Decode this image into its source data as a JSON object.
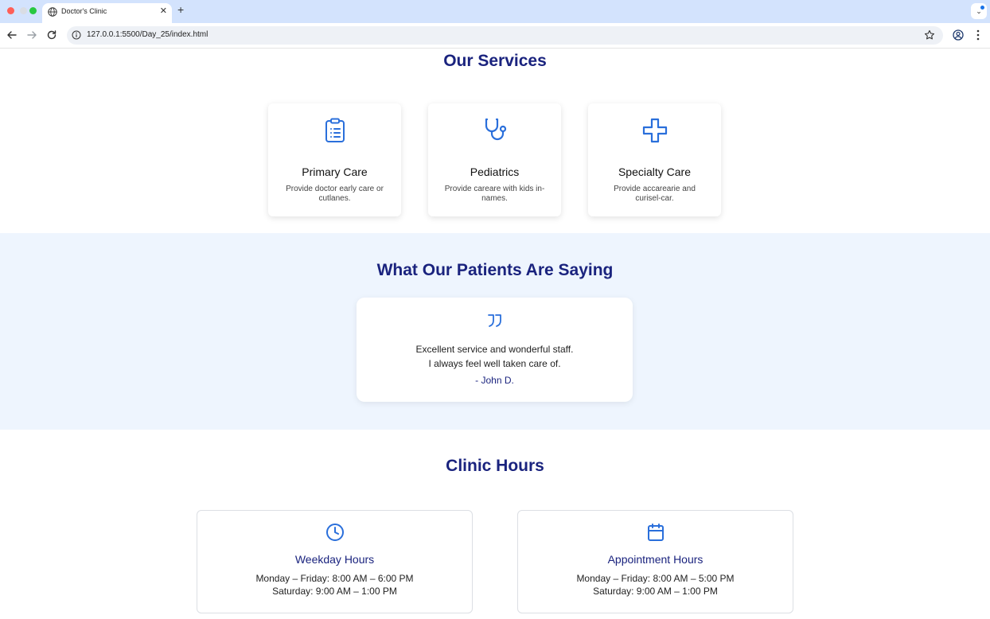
{
  "browser": {
    "tab_title": "Doctor's Clinic",
    "url": "127.0.0.1:5500/Day_25/index.html"
  },
  "services": {
    "title": "Our Services",
    "items": [
      {
        "icon": "clipboard-icon",
        "title": "Primary Care",
        "desc": "Provide doctor early care or cutlanes."
      },
      {
        "icon": "stethoscope-icon",
        "title": "Pediatrics",
        "desc": "Provide careare with kids in-names."
      },
      {
        "icon": "plus-cross-icon",
        "title": "Specialty Care",
        "desc": "Provide accarearie and curisel-car."
      }
    ]
  },
  "testimonials": {
    "title": "What Our Patients Are Saying",
    "quote_line1": "Excellent service and wonderful staff.",
    "quote_line2": "I always feel well taken care of.",
    "author": "- John D."
  },
  "hours": {
    "title": "Clinic Hours",
    "cards": [
      {
        "icon": "clock-icon",
        "title": "Weekday Hours",
        "line1": "Monday – Friday: 8:00 AM – 6:00 PM",
        "line2": "Saturday: 9:00 AM – 1:00 PM"
      },
      {
        "icon": "calendar-icon",
        "title": "Appointment Hours",
        "line1": "Monday – Friday: 8:00 AM – 5:00 PM",
        "line2": "Saturday: 9:00 AM – 1:00 PM"
      }
    ]
  },
  "colors": {
    "accent": "#2a6fdb",
    "heading": "#1a237e",
    "testimonial_bg": "#eef5fe"
  }
}
